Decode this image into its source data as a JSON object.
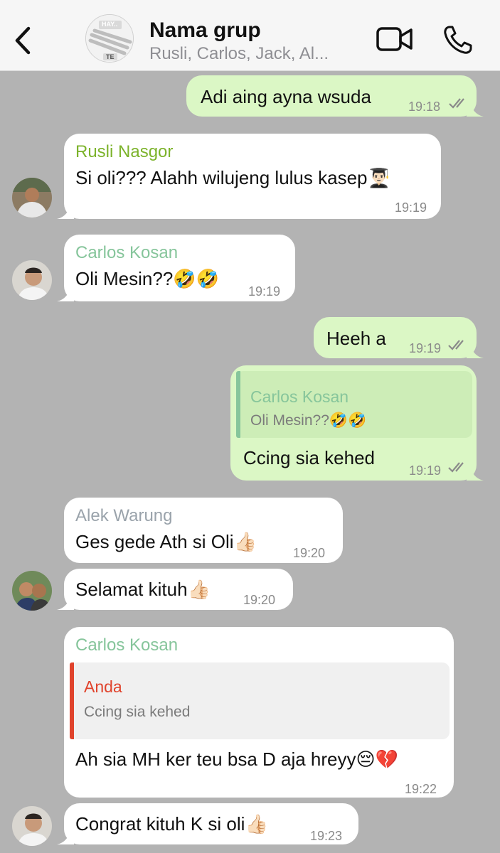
{
  "header": {
    "title": "Nama grup",
    "members": "Rusli, Carlos, Jack, Al...",
    "avatar_text_top": "HAY..",
    "avatar_text_bottom": "TE"
  },
  "colors": {
    "outgoing_bubble": "#dbf7c5",
    "incoming_bubble": "#ffffff",
    "background": "#b3b3b3",
    "rusli": "#7cb32b",
    "carlos": "#86c59b",
    "alek": "#9aa3ab",
    "anda": "#e0432c"
  },
  "messages": [
    {
      "type": "out",
      "text": "Adi aing ayna wsuda",
      "time": "19:18"
    },
    {
      "type": "in",
      "sender": "Rusli Nasgor",
      "text": "Si oli??? Alahh wilujeng lulus kasep👨🏻‍🎓",
      "time": "19:19"
    },
    {
      "type": "in",
      "sender": "Carlos Kosan",
      "text": "Oli Mesin??🤣🤣",
      "time": "19:19"
    },
    {
      "type": "out",
      "text": "Heeh a",
      "time": "19:19"
    },
    {
      "type": "out",
      "quote_sender": "Carlos Kosan",
      "quote_text": "Oli Mesin??🤣🤣",
      "text": "Ccing sia kehed",
      "time": "19:19"
    },
    {
      "type": "in",
      "sender": "Alek Warung",
      "text": "Ges gede Ath si Oli👍🏻",
      "time": "19:20"
    },
    {
      "type": "in",
      "text": "Selamat kituh👍🏻",
      "time": "19:20"
    },
    {
      "type": "in",
      "sender": "Carlos Kosan",
      "quote_sender": "Anda",
      "quote_text": "Ccing sia kehed",
      "text": "Ah sia MH ker teu bsa D aja hreyy😔💔",
      "time": "19:22"
    },
    {
      "type": "in",
      "text": "Congrat kituh K si oli👍🏻",
      "time": "19:23"
    }
  ]
}
